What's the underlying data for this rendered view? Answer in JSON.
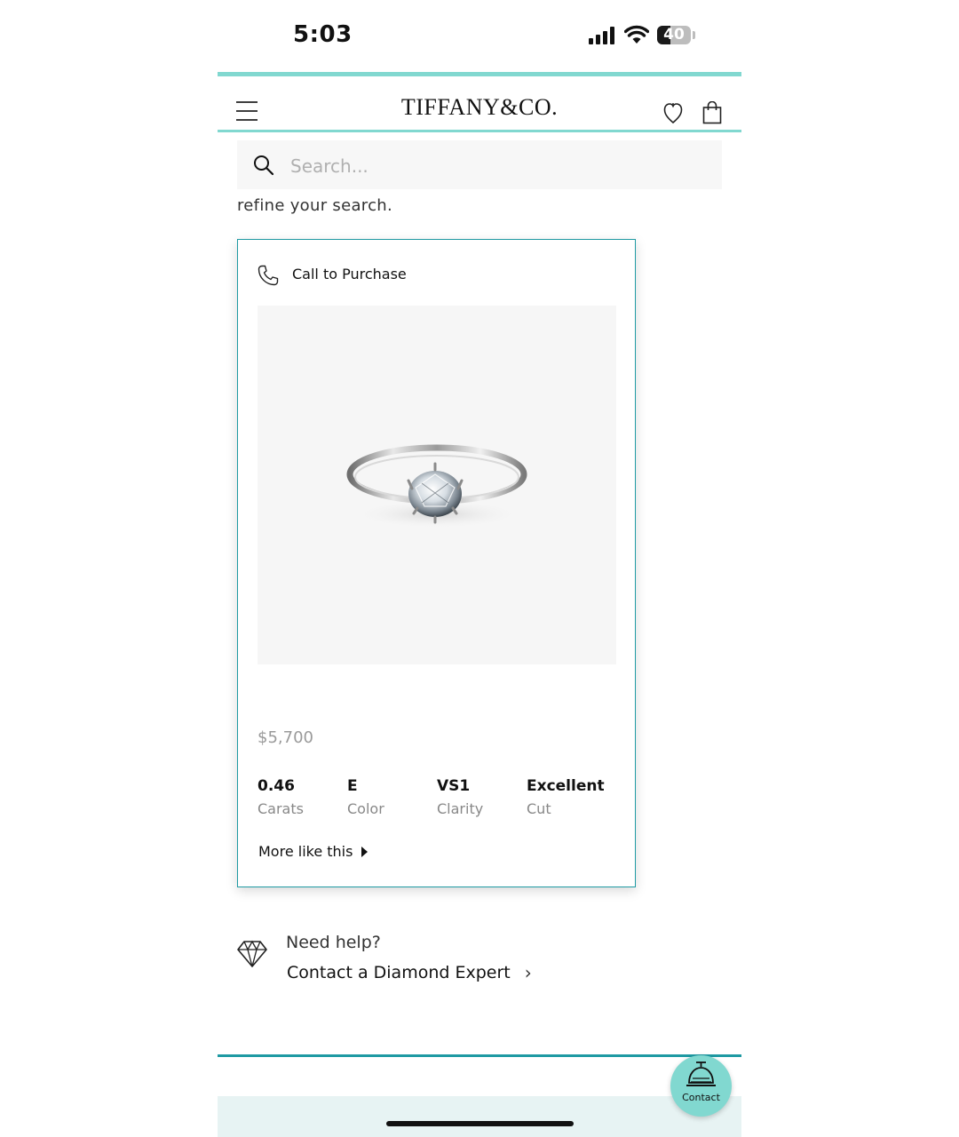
{
  "status_bar": {
    "time": "5:03",
    "battery": "40",
    "battery_level": 0.4
  },
  "header": {
    "logo": "TIFFANY&CO.",
    "menu_icon": "hamburger-menu-icon",
    "wishlist_icon": "heart-icon",
    "bag_icon": "shopping-bag-icon"
  },
  "search": {
    "placeholder": "Search..."
  },
  "refine_text": "refine your search.",
  "card": {
    "call_label": "Call to Purchase",
    "price": "$5,700",
    "specs": [
      {
        "value": "0.46",
        "label": "Carats"
      },
      {
        "value": "E",
        "label": "Color"
      },
      {
        "value": "VS1",
        "label": "Clarity"
      },
      {
        "value": "Excellent",
        "label": "Cut"
      }
    ],
    "more_link": "More like this"
  },
  "help": {
    "label": "Need help?",
    "link": "Contact a Diamond Expert"
  },
  "contact_button": {
    "label": "Contact"
  },
  "colors": {
    "tiffany_blue": "#81d8d0",
    "card_border": "#1f9aa3"
  }
}
